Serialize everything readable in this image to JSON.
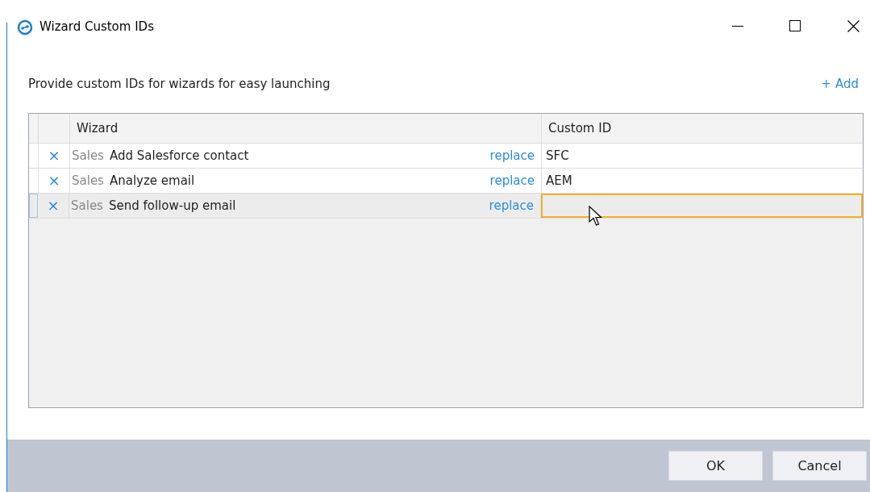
{
  "window": {
    "title": "Wizard Custom IDs"
  },
  "description": "Provide custom IDs for wizards for easy launching",
  "add_link": "+ Add",
  "table": {
    "columns": [
      "Wizard",
      "Custom ID"
    ],
    "rows": [
      {
        "remove": "×",
        "category": "Sales",
        "wizard": "Add Salesforce contact",
        "action": "replace",
        "custom_id": "SFC",
        "selected": false,
        "editing": false
      },
      {
        "remove": "×",
        "category": "Sales",
        "wizard": "Analyze email",
        "action": "replace",
        "custom_id": "AEM",
        "selected": false,
        "editing": false
      },
      {
        "remove": "×",
        "category": "Sales",
        "wizard": "Send follow-up email",
        "action": "replace",
        "selected": true,
        "editing": true
      }
    ]
  },
  "buttons": [
    "OK",
    "Cancel"
  ]
}
